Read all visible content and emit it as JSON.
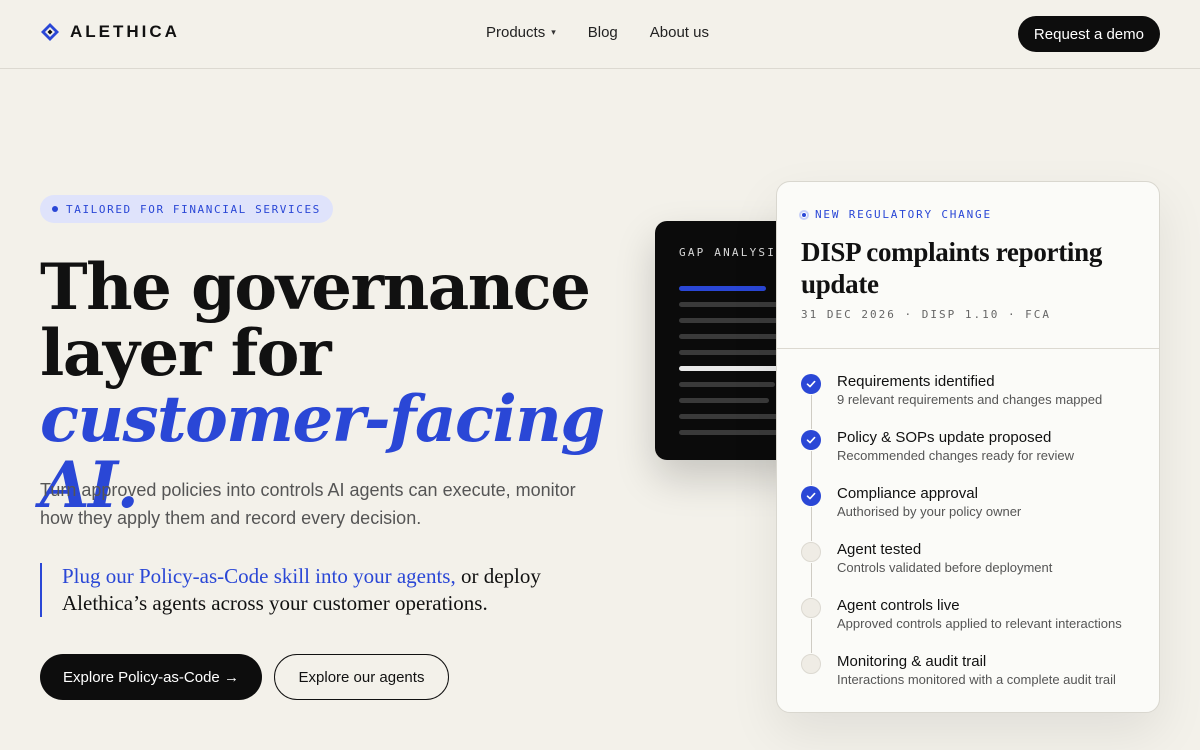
{
  "brand": {
    "name": "ALETHICA"
  },
  "nav": {
    "items": [
      {
        "label": "Products",
        "has_dropdown": true
      },
      {
        "label": "Blog",
        "has_dropdown": false
      },
      {
        "label": "About us",
        "has_dropdown": false
      }
    ],
    "dropdown_caret": "▾",
    "cta_label": "Request a demo"
  },
  "hero": {
    "badge": "TAILORED FOR FINANCIAL SERVICES",
    "headline_line1": "The governance",
    "headline_line2": "layer for",
    "headline_accent": "customer-facing AI.",
    "lede": "Turn approved policies into controls AI agents can execute, monitor how they apply them and record every decision.",
    "quote_highlight": "Plug our Policy-as-Code skill into your agents,",
    "quote_rest": "or deploy Alethica’s agents across your customer operations.",
    "primary_button": "Explore Policy-as-Code →",
    "secondary_button": "Explore our agents"
  },
  "gap_card": {
    "title": "GAP ANALYSIS"
  },
  "reg_card": {
    "eyebrow": "NEW REGULATORY CHANGE",
    "title": "DISP complaints reporting update",
    "meta": "31 DEC 2026 · DISP 1.10 · FCA",
    "steps": [
      {
        "title": "Requirements identified",
        "desc": "9 relevant requirements and changes mapped",
        "status": "done"
      },
      {
        "title": "Policy & SOPs update proposed",
        "desc": "Recommended changes ready for review",
        "status": "done"
      },
      {
        "title": "Compliance approval",
        "desc": "Authorised by your policy owner",
        "status": "done"
      },
      {
        "title": "Agent tested",
        "desc": "Controls validated before deployment",
        "status": "pending"
      },
      {
        "title": "Agent controls live",
        "desc": "Approved controls applied to relevant interactions",
        "status": "pending"
      },
      {
        "title": "Monitoring & audit trail",
        "desc": "Interactions monitored with a complete audit trail",
        "status": "pending"
      }
    ]
  },
  "colors": {
    "accent": "#2a47d6",
    "background": "#f3f1ea",
    "dark": "#0d0d0d",
    "badge_bg": "#dfe3fb"
  }
}
